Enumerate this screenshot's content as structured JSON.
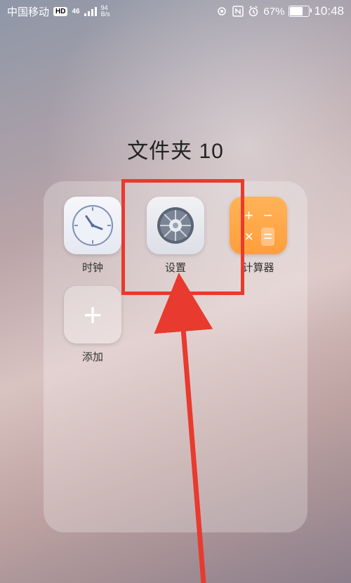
{
  "status": {
    "carrier": "中国移动",
    "hd_badge": "HD",
    "network_gen": "46",
    "net_rate_top": "94",
    "net_rate_bottom": "B/s",
    "battery_pct": "67%",
    "battery_fill_pct": 67,
    "time": "10:48"
  },
  "folder": {
    "title": "文件夹 10",
    "apps": [
      {
        "id": "clock",
        "label": "时钟",
        "icon": "clock-icon"
      },
      {
        "id": "settings",
        "label": "设置",
        "icon": "settings-icon"
      },
      {
        "id": "calc",
        "label": "计算器",
        "icon": "calculator-icon"
      },
      {
        "id": "add",
        "label": "添加",
        "icon": "add-icon"
      }
    ]
  },
  "annotation": {
    "highlight_target": "settings",
    "color": "#e83a2e"
  }
}
